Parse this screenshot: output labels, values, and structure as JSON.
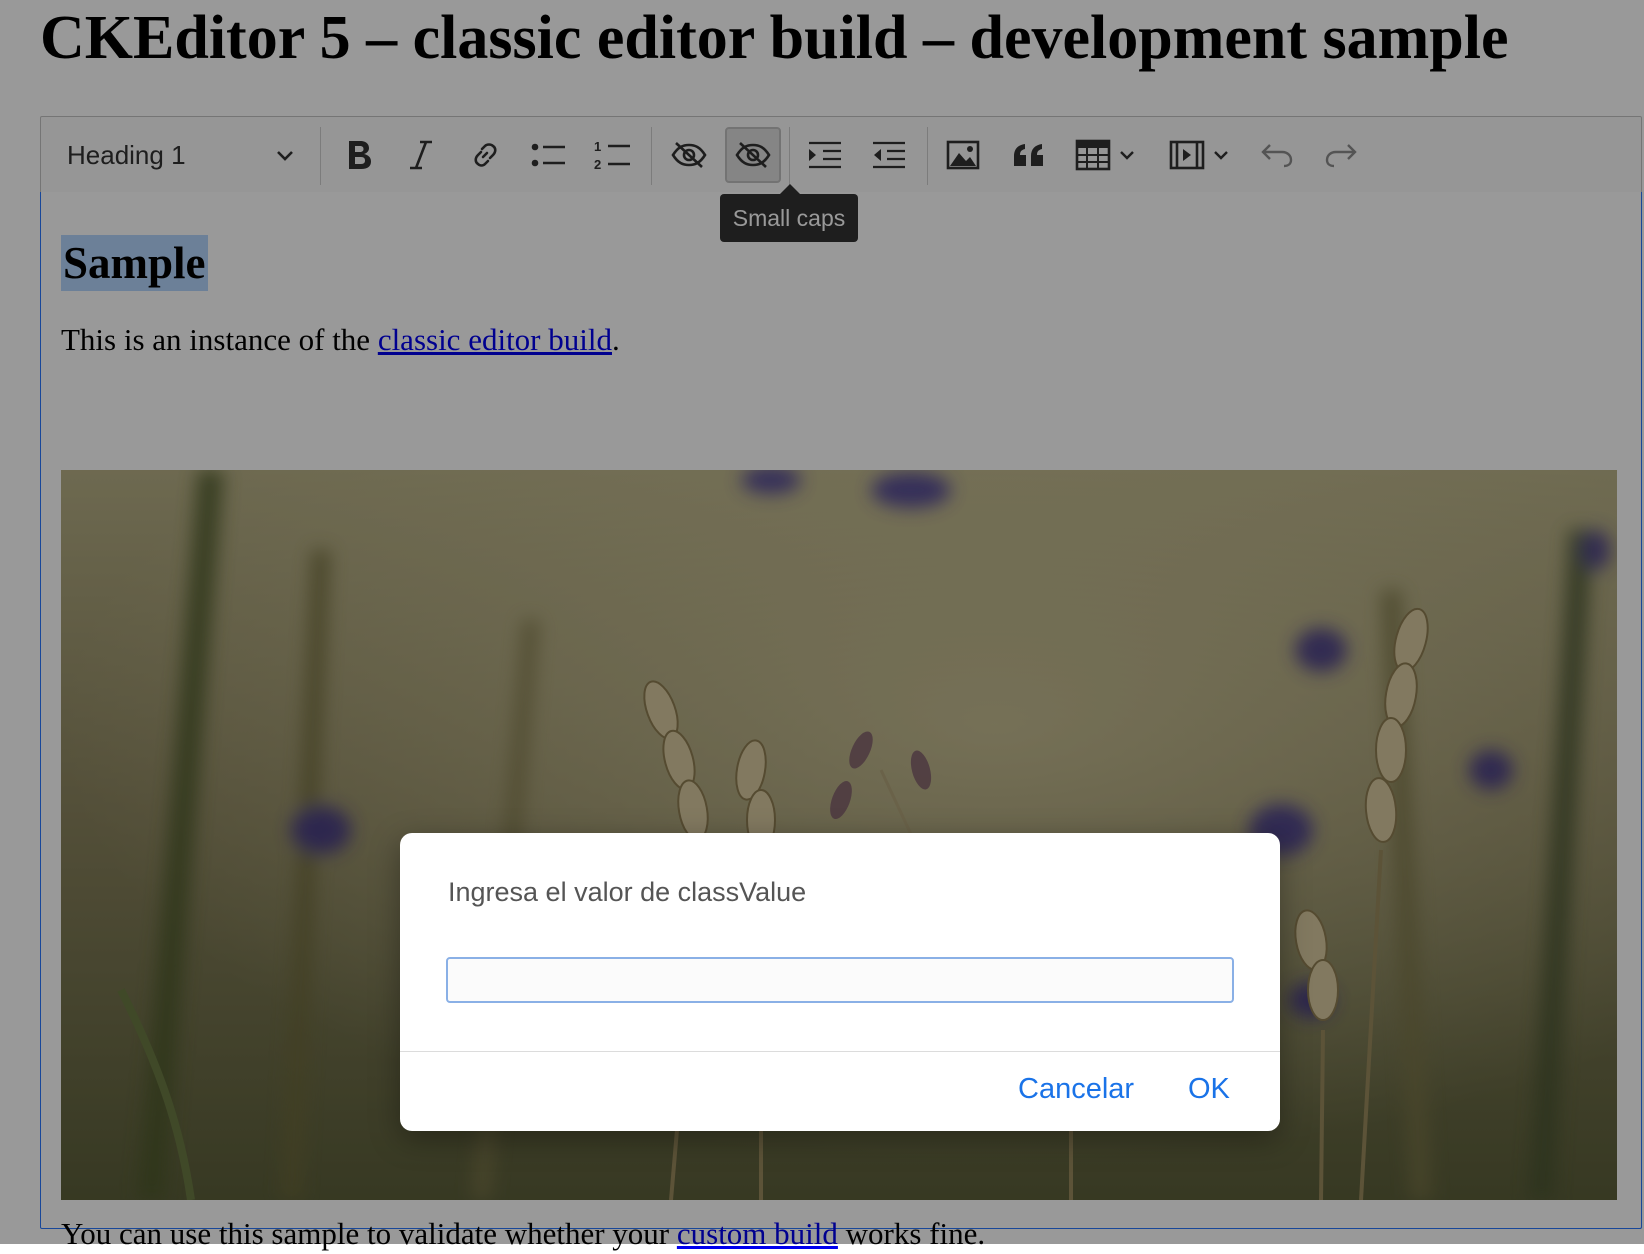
{
  "page": {
    "title": "CKEditor 5 – classic editor build – development sample"
  },
  "toolbar": {
    "heading_value": "Heading 1",
    "buttons": [
      {
        "name": "bold",
        "icon": "bold-icon"
      },
      {
        "name": "italic",
        "icon": "italic-icon"
      },
      {
        "name": "link",
        "icon": "link-icon"
      },
      {
        "name": "bulleted-list",
        "icon": "bulleted-list-icon"
      },
      {
        "name": "numbered-list",
        "icon": "numbered-list-icon"
      },
      {
        "name": "hidden",
        "icon": "eye-slash-icon"
      },
      {
        "name": "small-caps",
        "icon": "eye-slash-icon",
        "active": true
      },
      {
        "name": "indent",
        "icon": "indent-icon"
      },
      {
        "name": "outdent",
        "icon": "outdent-icon"
      },
      {
        "name": "insert-image",
        "icon": "image-icon"
      },
      {
        "name": "block-quote",
        "icon": "quote-icon"
      },
      {
        "name": "insert-table",
        "icon": "table-icon"
      },
      {
        "name": "insert-media",
        "icon": "media-icon"
      },
      {
        "name": "undo",
        "icon": "undo-icon"
      },
      {
        "name": "redo",
        "icon": "redo-icon"
      }
    ],
    "tooltip": "Small caps"
  },
  "content": {
    "heading": "Sample",
    "paragraph1": {
      "before": "This is an instance of the ",
      "link": "classic editor build",
      "after": "."
    },
    "image_alt": "wheat-field-photo",
    "paragraph2": {
      "before": "You can use this sample to validate whether your ",
      "link": "custom build",
      "after": " works fine."
    }
  },
  "dialog": {
    "message": "Ingresa el valor de classValue",
    "input_value": "",
    "cancel_label": "Cancelar",
    "ok_label": "OK"
  },
  "colors": {
    "accent": "#1a73e8",
    "selection": "#b4d5fe",
    "link": "#0000ee",
    "focus_border": "#2977ff"
  }
}
